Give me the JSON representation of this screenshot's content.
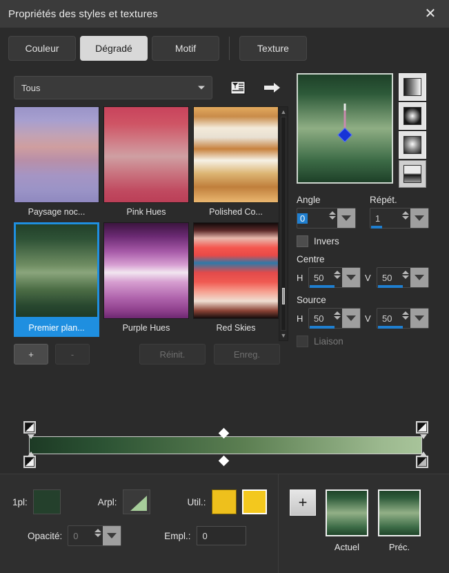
{
  "window": {
    "title": "Propriétés des styles et textures",
    "close_icon": "close-icon",
    "close_glyph": "✕"
  },
  "tabs": [
    {
      "label": "Couleur",
      "active": false
    },
    {
      "label": "Dégradé",
      "active": true
    },
    {
      "label": "Motif",
      "active": false
    },
    {
      "label": "Texture",
      "active": false
    }
  ],
  "toolbar": {
    "category_value": "Tous",
    "list_icon": "list-view-icon",
    "arrow_icon": "arrow-right-icon"
  },
  "gradients": [
    {
      "name": "Paysage noc...",
      "css": "linear-gradient(to bottom,#9a94c8 0%,#a79fcf 14%,#c2a2b4 30%,#cf9e9f 42%,#b88fa8 56%,#a595c4 72%,#9a93c6 88%,#8f88bf 100%)"
    },
    {
      "name": "Pink Hues",
      "css": "linear-gradient(to bottom,#c8435c 0%,#cf5565 18%,#d08a92 42%,#cf9fa2 52%,#c9737f 70%,#c04a60 88%,#bb3f57 100%)"
    },
    {
      "name": "Polished Co...",
      "css": "linear-gradient(to bottom,#e2a95e 0%,#c98c4a 10%,#f3ead9 22%,#e8e0d2 32%,#c8823e 44%,#f6f1e6 56%,#dcb472 70%,#c07f3c 84%,#eab770 100%)"
    },
    {
      "name": "Premier plan...",
      "css": "linear-gradient(to bottom,#22402a 0%,#2e5236 16%,#6f8d62 44%,#8aa57c 52%,#4d6e46 70%,#28472f 88%,#1f3b27 100%)",
      "selected": true
    },
    {
      "name": "Purple Hues",
      "css": "linear-gradient(to bottom,#3c1540 0%,#6b2a73 14%,#a75aa8 30%,#d79fd2 44%,#f2e6f0 52%,#d69ed0 62%,#b166ae 78%,#8e3f8c 92%,#6d2871 100%)"
    },
    {
      "name": "Red Skies",
      "css": "linear-gradient(to bottom,#120a0a 0%,#5d2a2a 8%,#e8b8ad 16%,#f4564e 26%,#e84a48 34%,#2f79a8 42%,#e24a4a 52%,#f05a52 62%,#f6a090 72%,#efded2 82%,#8c4436 92%,#140c0c 100%)"
    }
  ],
  "list_actions": {
    "add_label": "+",
    "remove_label": "-",
    "reset_label": "Réinit.",
    "save_label": "Enreg."
  },
  "gradient_editor": {
    "bar_css": "linear-gradient(to right,#1d3a25 0%,#2b5233 18%,#5c7f52 55%,#9cb98f 90%,#a8c49a 100%)",
    "stops": [
      {
        "position": 0
      },
      {
        "position": 100
      }
    ],
    "midpoints": [
      {
        "position": 50
      }
    ]
  },
  "settings": {
    "preview_name": "gradient-preview",
    "types": [
      {
        "name": "linear",
        "active": false
      },
      {
        "name": "rectangular",
        "active": false
      },
      {
        "name": "radial",
        "active": false
      },
      {
        "name": "sunburst",
        "active": true
      }
    ],
    "angle_label": "Angle",
    "angle_value": "0",
    "repeat_label": "Répét.",
    "repeat_value": "1",
    "invers_label": "Invers",
    "invers_checked": false,
    "centre_label": "Centre",
    "centre_h_label": "H",
    "centre_h_value": "50",
    "centre_v_label": "V",
    "centre_v_value": "50",
    "source_label": "Source",
    "source_h_label": "H",
    "source_h_value": "50",
    "source_v_label": "V",
    "source_v_value": "50",
    "liaison_label": "Liaison",
    "liaison_checked": false
  },
  "bottombar": {
    "fg_label": "1pl:",
    "fg_color": "#24402c",
    "arpl_label": "Arpl:",
    "arpl_color": "#a6cd9a",
    "util_label": "Util.:",
    "util_color_1": "#eec01c",
    "util_color_2": "#f3c81e",
    "opacity_label": "Opacité:",
    "opacity_value": "0",
    "empl_label": "Empl.:",
    "empl_value": "0",
    "plus_label": "+",
    "current_label": "Actuel",
    "previous_label": "Préc."
  }
}
